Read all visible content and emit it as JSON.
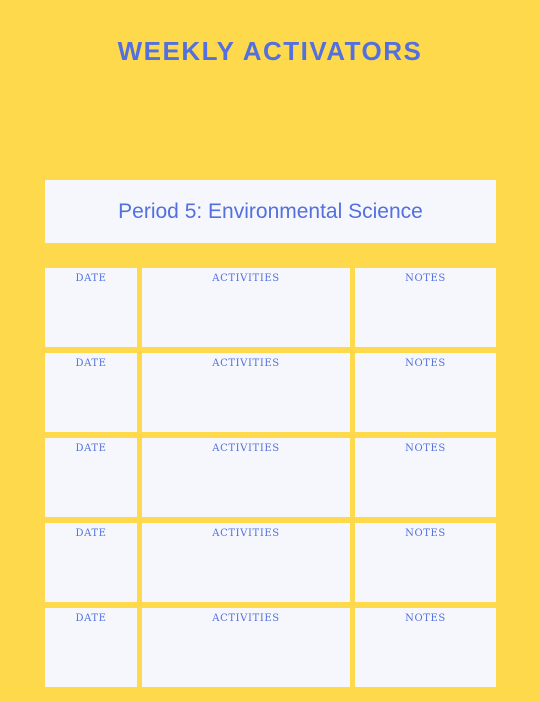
{
  "header": {
    "title": "WEEKLY ACTIVATORS"
  },
  "period": {
    "label": "Period 5: Environmental Science"
  },
  "columns": {
    "date": "DATE",
    "activities": "ACTIVITIES",
    "notes": "NOTES"
  },
  "rows": [
    {
      "date": "DATE",
      "activities": "ACTIVITIES",
      "notes": "NOTES"
    },
    {
      "date": "DATE",
      "activities": "ACTIVITIES",
      "notes": "NOTES"
    },
    {
      "date": "DATE",
      "activities": "ACTIVITIES",
      "notes": "NOTES"
    },
    {
      "date": "DATE",
      "activities": "ACTIVITIES",
      "notes": "NOTES"
    },
    {
      "date": "DATE",
      "activities": "ACTIVITIES",
      "notes": "NOTES"
    }
  ],
  "colors": {
    "background": "#FED94B",
    "accent": "#5370DE",
    "panel": "#F5F7FC"
  }
}
